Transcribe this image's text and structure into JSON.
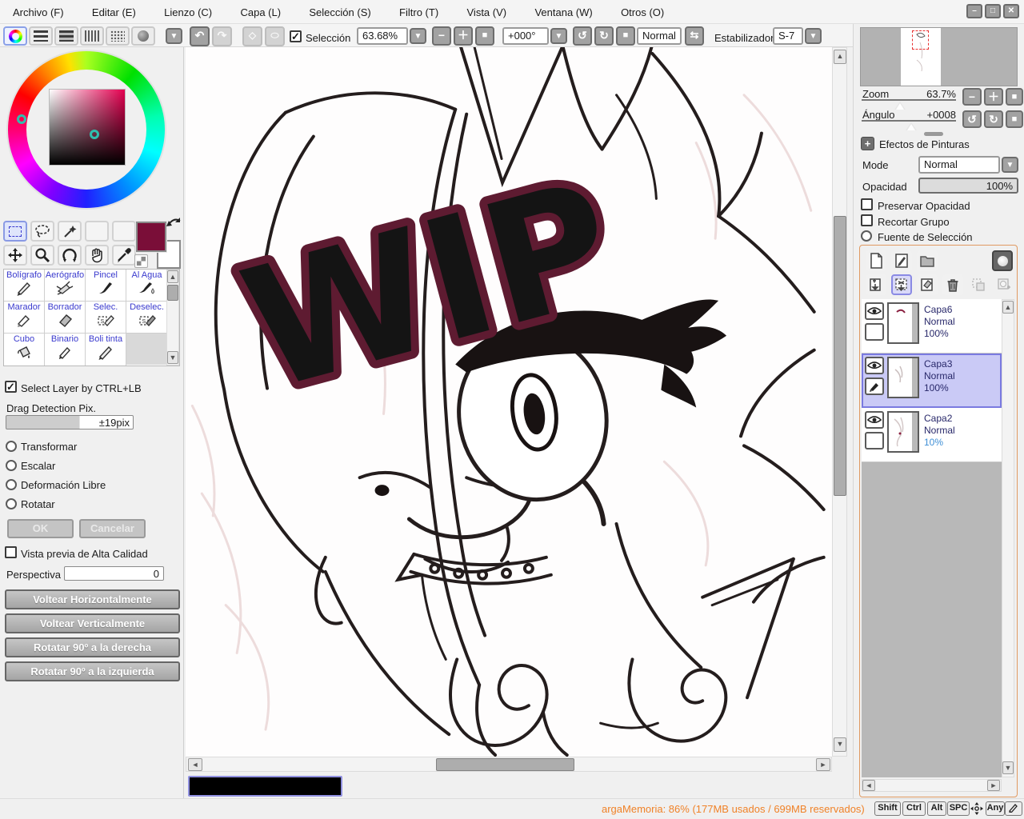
{
  "menu": {
    "items": [
      "Archivo (F)",
      "Editar (E)",
      "Lienzo (C)",
      "Capa (L)",
      "Selección (S)",
      "Filtro (T)",
      "Vista (V)",
      "Ventana (W)",
      "Otros (O)"
    ]
  },
  "window_controls": {
    "minimize": "–",
    "maximize": "□",
    "close": "✕"
  },
  "toolbar": {
    "selection_label": "Selección",
    "zoom_value": "63.68%",
    "angle_value": "+000°",
    "blend_button": "Normal",
    "stabilizer_label": "Estabilizador",
    "stabilizer_value": "S-7"
  },
  "left_panel": {
    "brushes": [
      "Bolígrafo",
      "Aerógrafo",
      "Pincel",
      "Al Agua",
      "Marador",
      "Borrador",
      "Selec.",
      "Deselec.",
      "Cubo",
      "Binario",
      "Boli tinta"
    ],
    "select_layer_label": "Select Layer by CTRL+LB",
    "drag_detection_label": "Drag Detection Pix.",
    "drag_detection_value": "±19pix",
    "radio_options": [
      "Transformar",
      "Escalar",
      "Deformación Libre",
      "Rotatar"
    ],
    "ok_label": "OK",
    "cancel_label": "Cancelar",
    "high_quality_preview_label": "Vista previa de Alta Calidad",
    "perspective_label": "Perspectiva",
    "perspective_value": "0",
    "action_buttons": [
      "Voltear Horizontalmente",
      "Voltear Verticalmente",
      "Rotatar 90º a la derecha",
      "Rotatar 90º a la izquierda"
    ]
  },
  "canvas": {
    "wip_text": "WIP"
  },
  "right_panel": {
    "zoom_label": "Zoom",
    "zoom_value": "63.7%",
    "angle_label": "Ángulo",
    "angle_value": "+0008",
    "paint_effects_label": "Efectos de Pinturas",
    "mode_label": "Mode",
    "mode_value": "Normal",
    "opacity_label": "Opacidad",
    "opacity_value": "100%",
    "preserve_opacity_label": "Preservar Opacidad",
    "clipping_group_label": "Recortar Grupo",
    "selection_source_label": "Fuente de Selección",
    "layers": [
      {
        "name": "Capa6",
        "mode": "Normal",
        "opacity": "100%"
      },
      {
        "name": "Capa3",
        "mode": "Normal",
        "opacity": "100%"
      },
      {
        "name": "Capa2",
        "mode": "Normal",
        "opacity": "10%"
      }
    ]
  },
  "status_bar": {
    "memory_text": "argaMemoria: 86% (177MB usados / 699MB reservados)",
    "key_shift": "Shift",
    "key_ctrl": "Ctrl",
    "key_alt": "Alt",
    "key_spc": "SPC",
    "key_any": "Any"
  },
  "colors": {
    "foreground_color": "#7a0e38",
    "panel_orange_border": "#e09a62",
    "memory_text_orange": "#f08228",
    "layer_selected_bg": "#cacaf6",
    "tool_name_blue": "#3a3ace",
    "selection_accent": "#8585e0"
  }
}
